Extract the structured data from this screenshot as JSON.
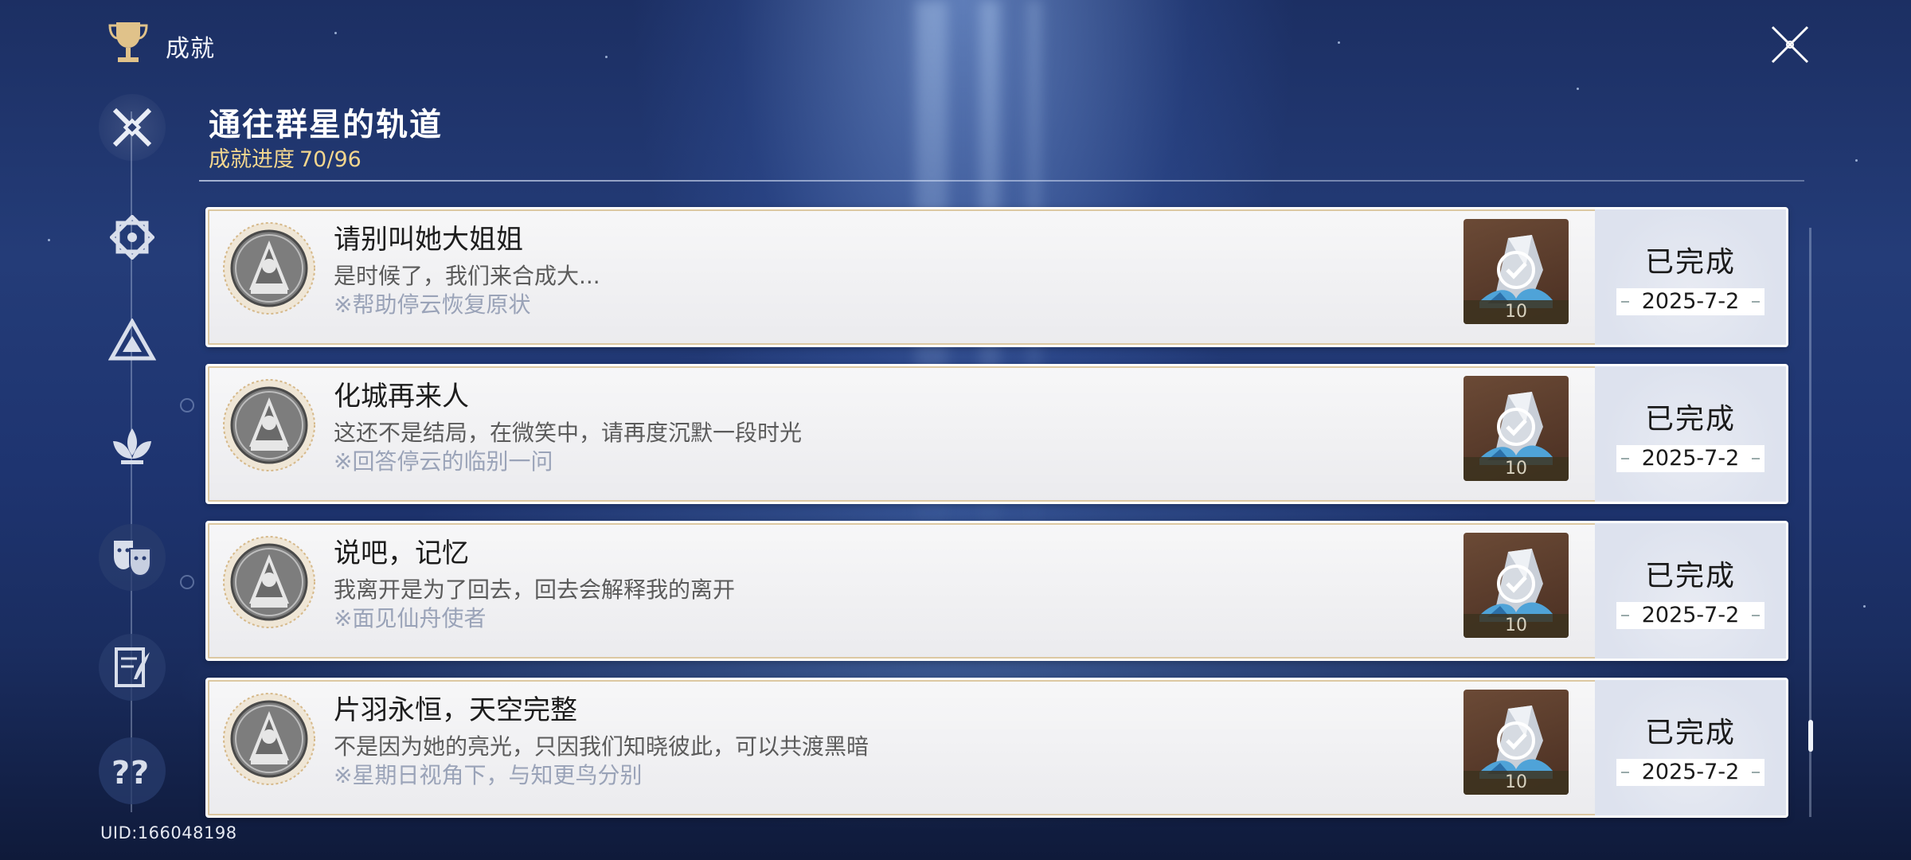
{
  "header": {
    "title": "成就",
    "trophy_icon": "trophy-icon",
    "close_icon": "close-icon"
  },
  "sidebar": {
    "items": [
      {
        "name": "sidebar-item-category-1",
        "icon": "crossed-swords-icon",
        "active": true
      },
      {
        "name": "sidebar-item-category-2",
        "icon": "octagon-emblem-icon",
        "active": false
      },
      {
        "name": "sidebar-item-category-3",
        "icon": "triangle-emblem-icon",
        "active": false
      },
      {
        "name": "sidebar-item-category-4",
        "icon": "lotus-emblem-icon",
        "active": false
      },
      {
        "name": "sidebar-item-category-5",
        "icon": "theater-masks-icon",
        "active": false
      },
      {
        "name": "sidebar-item-category-6",
        "icon": "notebook-quill-icon",
        "active": false
      },
      {
        "name": "sidebar-item-category-7",
        "icon": "question-marks-icon",
        "active": false
      }
    ]
  },
  "category": {
    "title": "通往群星的轨道",
    "progress_label": "成就进度",
    "progress_value": "70/96"
  },
  "achievements": [
    {
      "name": "请别叫她大姐姐",
      "description": "是时候了，我们来合成大...",
      "hint": "※帮助停云恢复原状",
      "reward_qty": "10",
      "status": "已完成",
      "date": "2025-7-2"
    },
    {
      "name": "化城再来人",
      "description": "这还不是结局，在微笑中，请再度沉默一段时光",
      "hint": "※回答停云的临别一问",
      "reward_qty": "10",
      "status": "已完成",
      "date": "2025-7-2"
    },
    {
      "name": "说吧，记忆",
      "description": "我离开是为了回去，回去会解释我的离开",
      "hint": "※面见仙舟使者",
      "reward_qty": "10",
      "status": "已完成",
      "date": "2025-7-2"
    },
    {
      "name": "片羽永恒，天空完整",
      "description": "不是因为她的亮光，只因我们知晓彼此，可以共渡黑暗",
      "hint": "※星期日视角下，与知更鸟分别",
      "reward_qty": "10",
      "status": "已完成",
      "date": "2025-7-2"
    }
  ],
  "footer": {
    "uid": "UID:166048198"
  },
  "colors": {
    "progress_gold": "#f3d68e",
    "card_bg": "#f2f2f4",
    "hint_blue_gray": "#9aa3b8"
  }
}
